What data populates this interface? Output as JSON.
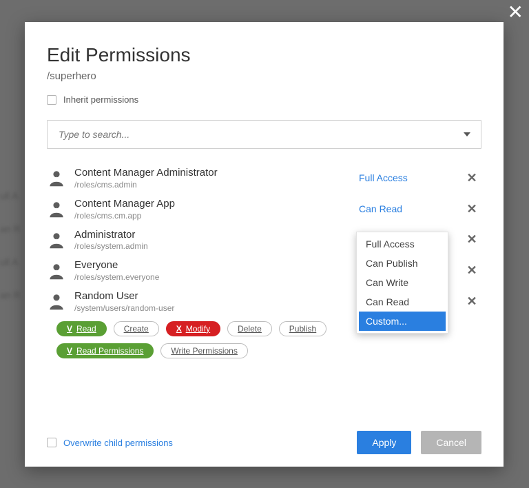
{
  "dialog": {
    "title": "Edit Permissions",
    "path": "/superhero",
    "inherit_label": "Inherit permissions",
    "overwrite_label": "Overwrite child permissions",
    "search_placeholder": "Type to search...",
    "close_glyph": "✕"
  },
  "principals": [
    {
      "name": "Content Manager Administrator",
      "path": "/roles/cms.admin",
      "access": "Full Access",
      "accent": true,
      "type": "role"
    },
    {
      "name": "Content Manager App",
      "path": "/roles/cms.cm.app",
      "access": "Can Read",
      "accent": true,
      "type": "role"
    },
    {
      "name": "Administrator",
      "path": "/roles/system.admin",
      "access": "",
      "accent": false,
      "type": "role"
    },
    {
      "name": "Everyone",
      "path": "/roles/system.everyone",
      "access": "",
      "accent": false,
      "type": "role"
    },
    {
      "name": "Random User",
      "path": "/system/users/random-user",
      "access": "",
      "accent": false,
      "type": "user"
    }
  ],
  "dropdown": {
    "options": [
      "Full Access",
      "Can Publish",
      "Can Write",
      "Can Read",
      "Custom..."
    ],
    "selected_index": 4
  },
  "custom_perms": {
    "row1": [
      {
        "prefix": "V",
        "label": "Read",
        "style": "green"
      },
      {
        "prefix": "",
        "label": "Create",
        "style": "plain"
      },
      {
        "prefix": "X",
        "label": "Modify",
        "style": "red"
      },
      {
        "prefix": "",
        "label": "Delete",
        "style": "plain"
      },
      {
        "prefix": "",
        "label": "Publish",
        "style": "plain"
      }
    ],
    "row2": [
      {
        "prefix": "V",
        "label": "Read Permissions",
        "style": "green"
      },
      {
        "prefix": "",
        "label": "Write Permissions",
        "style": "plain"
      }
    ]
  },
  "buttons": {
    "apply": "Apply",
    "cancel": "Cancel"
  },
  "bg_rows": [
    "ull A",
    "an R",
    "ull A",
    "an R"
  ]
}
